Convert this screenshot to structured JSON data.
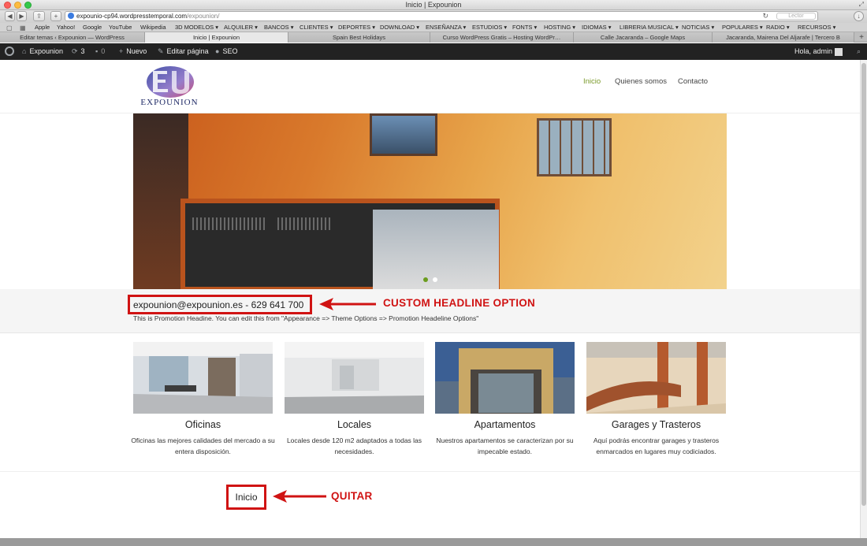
{
  "browser": {
    "window_title": "Inicio | Expounion",
    "url_host": "expounio-cp94.wordpresstemporal.com",
    "url_path": "/expounion/",
    "reader_label": "Lector",
    "bookmarks": [
      "Apple",
      "Yahoo!",
      "Google",
      "YouTube",
      "Wikipedia",
      "3D MODELOS ▾",
      "ALQUILER ▾",
      "BANCOS ▾",
      "CLIENTES ▾",
      "DEPORTES ▾",
      "DOWNLOAD ▾",
      "ENSEÑANZA ▾",
      "ESTUDIOS ▾",
      "FONTS ▾",
      "HOSTING ▾",
      "IDIOMAS ▾",
      "LIBRERIA MUSICAL ▾",
      "NOTICIAS ▾",
      "POPULARES ▾",
      "RADIO ▾",
      "RECURSOS ▾"
    ],
    "tabs": [
      {
        "label": "Editar temas ‹ Expounion — WordPress",
        "active": false
      },
      {
        "label": "Inicio | Expounion",
        "active": true
      },
      {
        "label": "Spain Best Holidays",
        "active": false
      },
      {
        "label": "Curso WordPress Gratis – Hosting WordPr…",
        "active": false
      },
      {
        "label": "Calle Jacaranda – Google Maps",
        "active": false
      },
      {
        "label": "Jacaranda, Mairena Del Aljarafe | Tercero B",
        "active": false
      }
    ]
  },
  "admin_bar": {
    "site_name": "Expounion",
    "updates_count": "3",
    "comments_count": "0",
    "new_label": "Nuevo",
    "edit_label": "Editar página",
    "seo_label": "SEO",
    "greeting": "Hola, admin"
  },
  "site": {
    "logo_text": "EXPOUNION",
    "nav": [
      {
        "label": "Inicio",
        "active": true
      },
      {
        "label": "Quienes somos",
        "active": false
      },
      {
        "label": "Contacto",
        "active": false
      }
    ]
  },
  "promo": {
    "headline": "expounion@expounion.es - 629 641 700",
    "subtext": "This is Promotion Headine. You can edit this from \"Appearance => Theme Options => Promotion Headeline Options\"",
    "annotation": "CUSTOM HEADLINE OPTION"
  },
  "features": [
    {
      "title": "Oficinas",
      "text": "Oficinas las mejores calidades del mercado a su entera disposición."
    },
    {
      "title": "Locales",
      "text": "Locales desde 120 m2 adaptados a todas las necesidades."
    },
    {
      "title": "Apartamentos",
      "text": "Nuestros apartamentos se caracterizan por su impecable estado."
    },
    {
      "title": "Garages y Trasteros",
      "text": "Aquí podrás encontrar garages y trasteros enmarcados en lugares muy codiciados."
    }
  ],
  "footer_annotation": {
    "page_title": "Inicio",
    "label": "QUITAR"
  },
  "colors": {
    "annotation_red": "#d01313",
    "nav_active": "#7a9a2a",
    "admin_bar": "#222222"
  }
}
